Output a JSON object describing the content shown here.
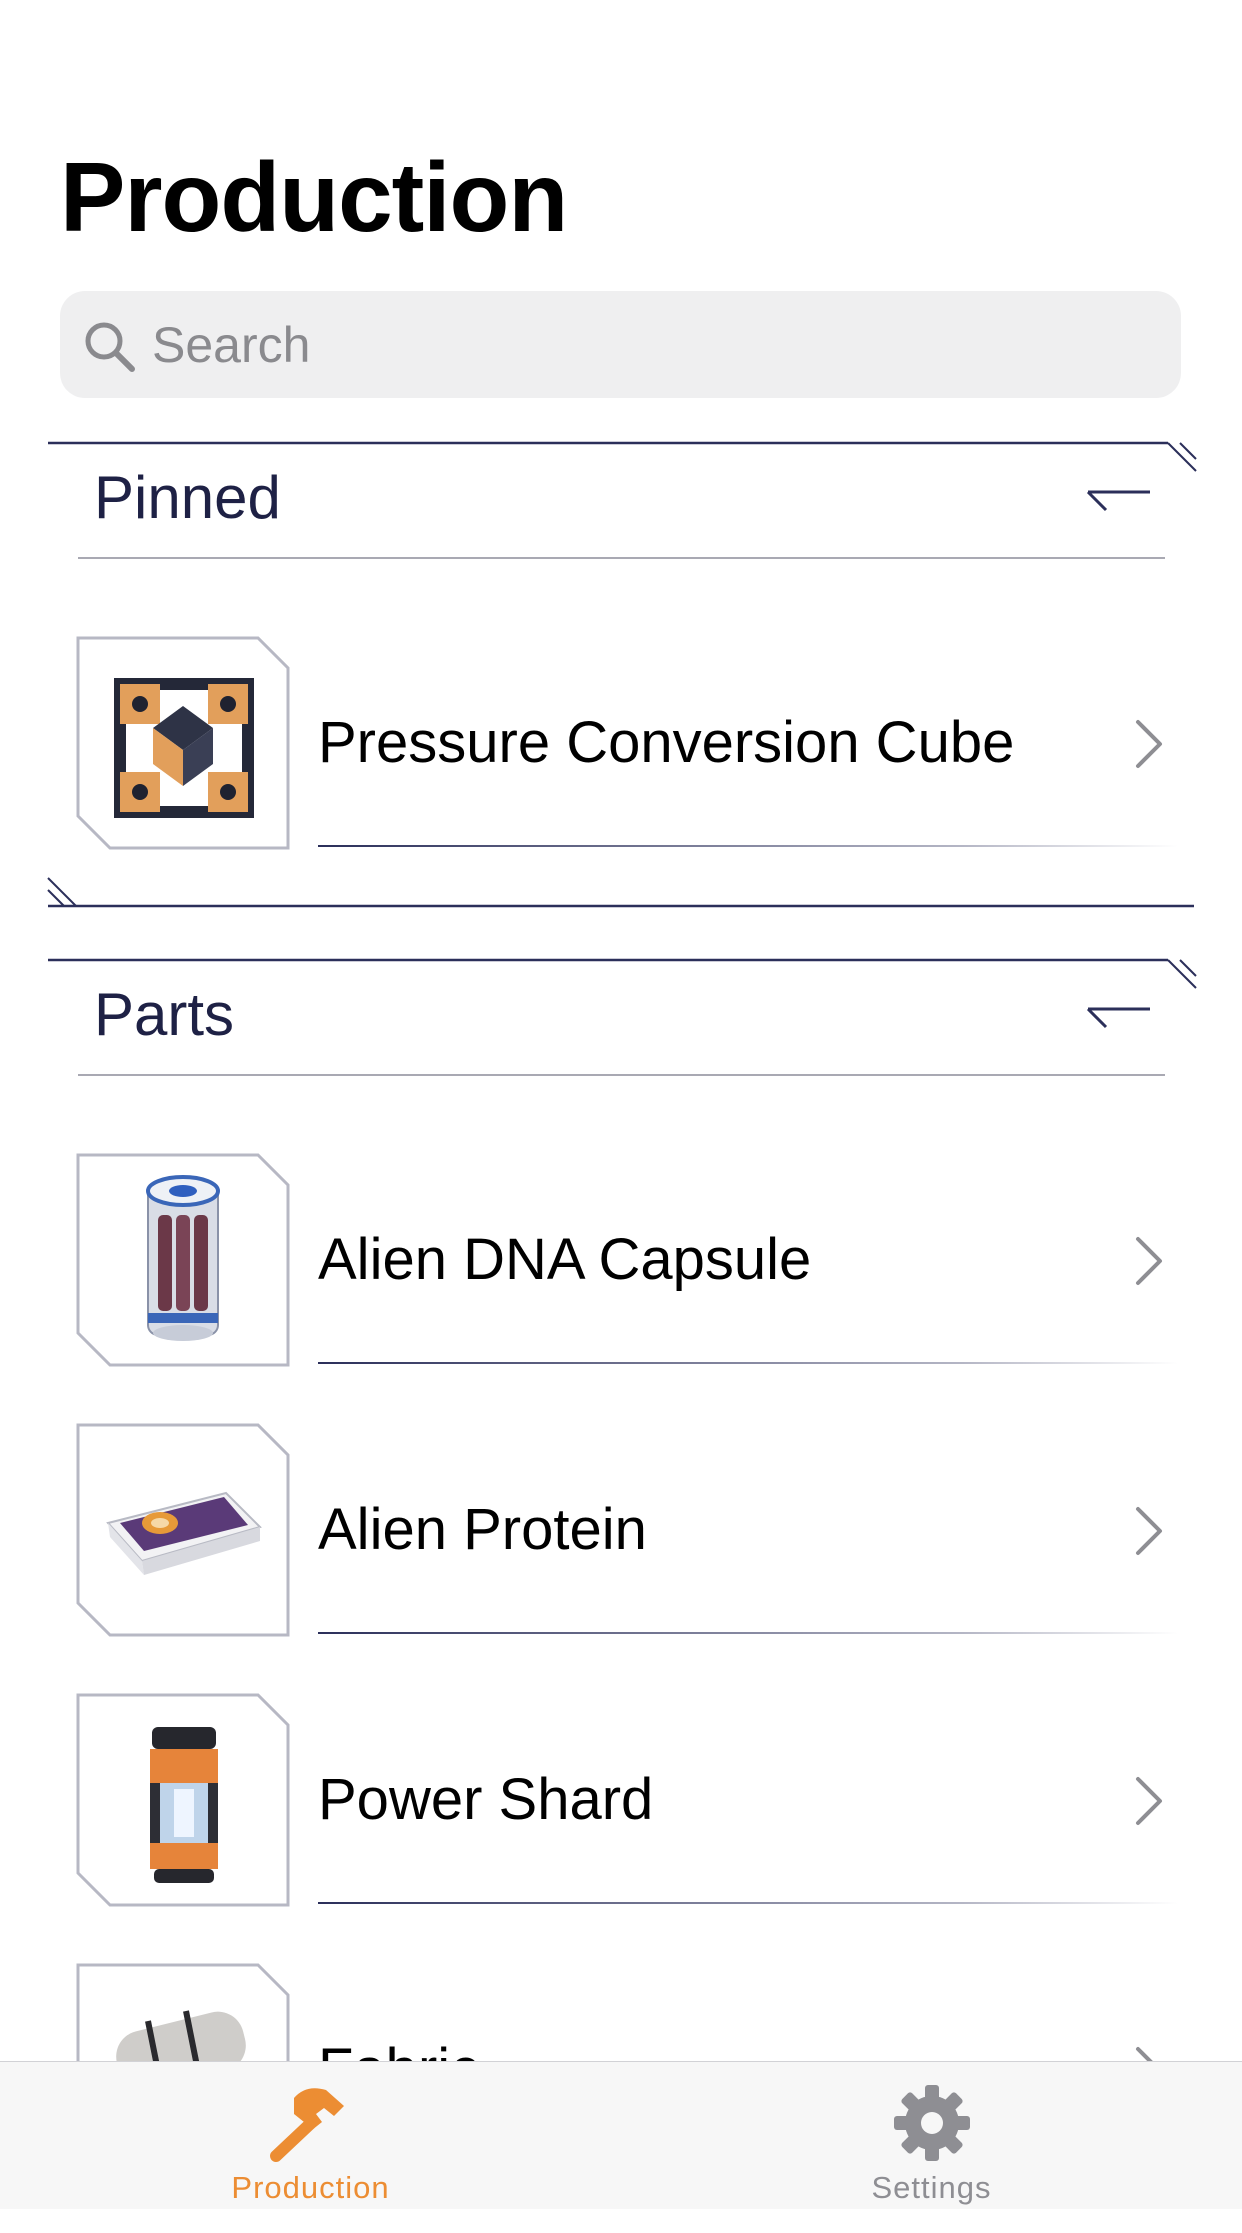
{
  "header": {
    "title": "Production"
  },
  "search": {
    "placeholder": "Search",
    "value": ""
  },
  "sections": [
    {
      "title": "Pinned",
      "items": [
        {
          "label": "Pressure Conversion Cube",
          "icon": "pressure-conversion-cube"
        }
      ]
    },
    {
      "title": "Parts",
      "items": [
        {
          "label": "Alien DNA Capsule",
          "icon": "alien-dna-capsule"
        },
        {
          "label": "Alien Protein",
          "icon": "alien-protein"
        },
        {
          "label": "Power Shard",
          "icon": "power-shard"
        },
        {
          "label": "Fabric",
          "icon": "fabric"
        }
      ]
    }
  ],
  "tabbar": {
    "tabs": [
      {
        "label": "Production",
        "icon": "hammer-icon",
        "selected": true
      },
      {
        "label": "Settings",
        "icon": "gear-icon",
        "selected": false
      }
    ]
  },
  "colors": {
    "accent": "#ec8d33",
    "inactive": "#8e8e93",
    "section_title": "#1e2145",
    "frame_line": "#2b2f5a"
  }
}
